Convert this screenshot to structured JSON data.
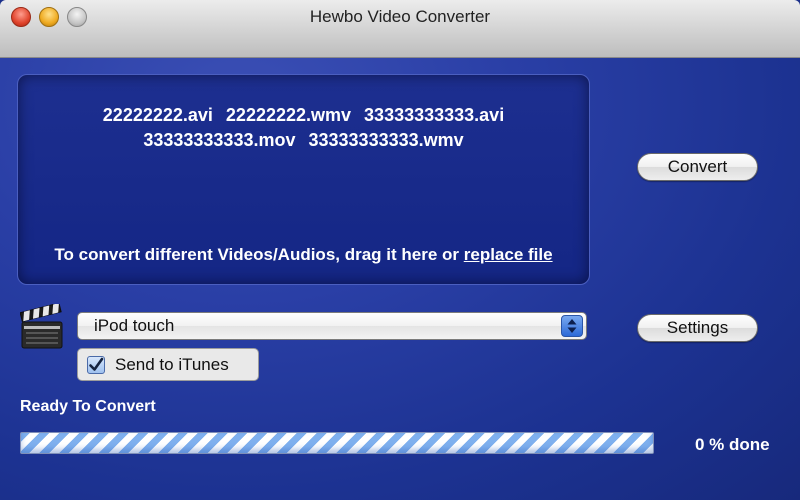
{
  "window": {
    "title": "Hewbo Video Converter"
  },
  "dropzone": {
    "files": [
      "22222222.avi",
      "22222222.wmv",
      "33333333333.avi",
      "33333333333.mov",
      "33333333333.wmv"
    ],
    "hint_text": "To convert different Videos/Audios, drag it here or ",
    "replace_link": "replace file"
  },
  "buttons": {
    "convert": "Convert",
    "settings": "Settings"
  },
  "format": {
    "selected": "iPod touch"
  },
  "itunes": {
    "label": "Send to iTunes",
    "checked": true
  },
  "progress": {
    "status": "Ready To Convert",
    "percent_text": "0 % done",
    "value": 0
  },
  "icons": [
    "close-icon",
    "minimize-icon",
    "zoom-icon",
    "clapperboard-icon",
    "updown-arrows-icon",
    "checkmark-icon"
  ],
  "colors": {
    "background": "#1c3291",
    "accent": "#2d6ad8"
  }
}
